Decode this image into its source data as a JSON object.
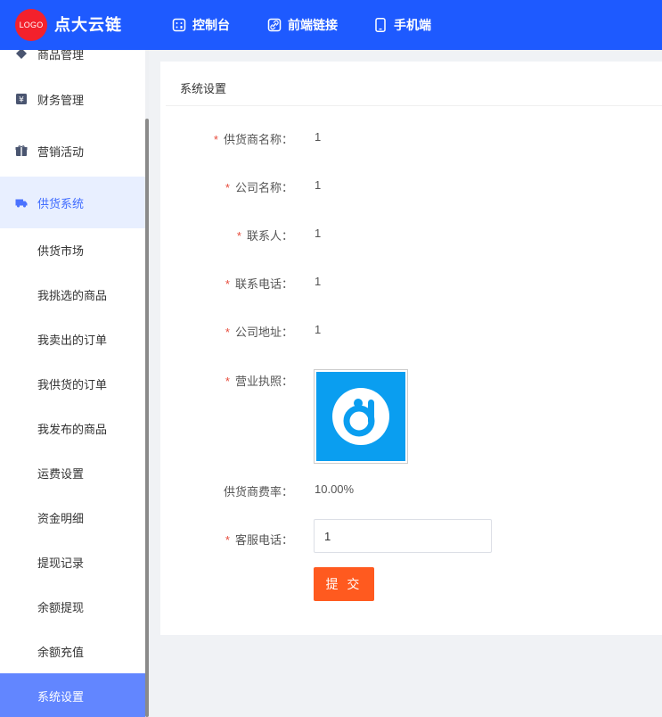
{
  "header": {
    "logo_text": "LOGO",
    "brand": "点大云链",
    "nav": [
      {
        "label": "控制台",
        "icon": "dashboard-icon"
      },
      {
        "label": "前端链接",
        "icon": "link-icon"
      },
      {
        "label": "手机端",
        "icon": "mobile-icon"
      }
    ]
  },
  "sidebar": {
    "partial_item": "商品管理",
    "menus": [
      {
        "label": "财务管理",
        "icon": "finance-icon"
      },
      {
        "label": "营销活动",
        "icon": "gift-icon"
      },
      {
        "label": "供货系统",
        "icon": "truck-icon"
      }
    ],
    "sub_items": [
      "供货市场",
      "我挑选的商品",
      "我卖出的订单",
      "我供货的订单",
      "我发布的商品",
      "运费设置",
      "资金明细",
      "提现记录",
      "余额提现",
      "余额充值",
      "系统设置"
    ]
  },
  "panel": {
    "title": "系统设置",
    "fields": {
      "supplier_name": {
        "label": "供货商名称：",
        "value": "1"
      },
      "company_name": {
        "label": "公司名称：",
        "value": "1"
      },
      "contact": {
        "label": "联系人：",
        "value": "1"
      },
      "contact_phone": {
        "label": "联系电话：",
        "value": "1"
      },
      "company_address": {
        "label": "公司地址：",
        "value": "1"
      },
      "business_license": {
        "label": "营业执照："
      },
      "fee_rate": {
        "label": "供货商费率：",
        "value": "10.00%"
      },
      "service_phone": {
        "label": "客服电话：",
        "value": "1"
      }
    },
    "required_mark": "*",
    "submit_label": "提 交"
  },
  "colors": {
    "header_bg": "#1e5aff",
    "accent": "#3f6bff",
    "selected_bg": "#6286ff",
    "submit_bg": "#ff5a1f",
    "required": "#e74c3c"
  }
}
